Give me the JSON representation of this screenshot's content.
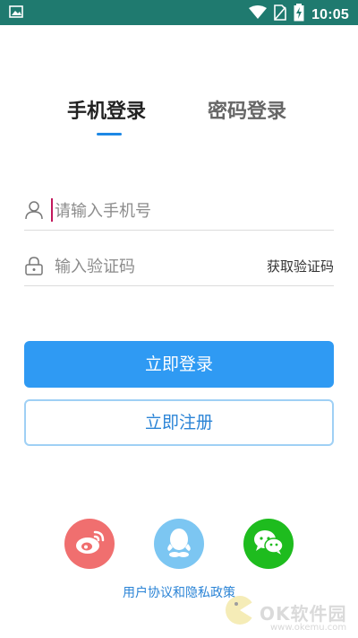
{
  "status_bar": {
    "time": "10:05",
    "icons": [
      "image-icon",
      "wifi-icon",
      "no-sim-icon",
      "battery-charging-icon"
    ]
  },
  "tabs": [
    {
      "label": "手机登录",
      "active": true
    },
    {
      "label": "密码登录",
      "active": false
    }
  ],
  "form": {
    "phone": {
      "placeholder": "请输入手机号",
      "value": "",
      "icon": "user-icon"
    },
    "code": {
      "placeholder": "输入验证码",
      "value": "",
      "icon": "lock-icon",
      "action_label": "获取验证码"
    }
  },
  "buttons": {
    "login_label": "立即登录",
    "register_label": "立即注册"
  },
  "social": [
    "weibo-icon",
    "qq-icon",
    "wechat-icon"
  ],
  "agreement_label": "用户协议和隐私政策",
  "watermark": {
    "text": "OK软件园",
    "url": "www.okemu.com"
  },
  "colors": {
    "status_bar": "#1f7a6f",
    "accent": "#2f9af3",
    "link": "#2b84d6",
    "weibo": "#f06f6f",
    "qq": "#7cc6f2",
    "wechat": "#1ebc1e"
  }
}
